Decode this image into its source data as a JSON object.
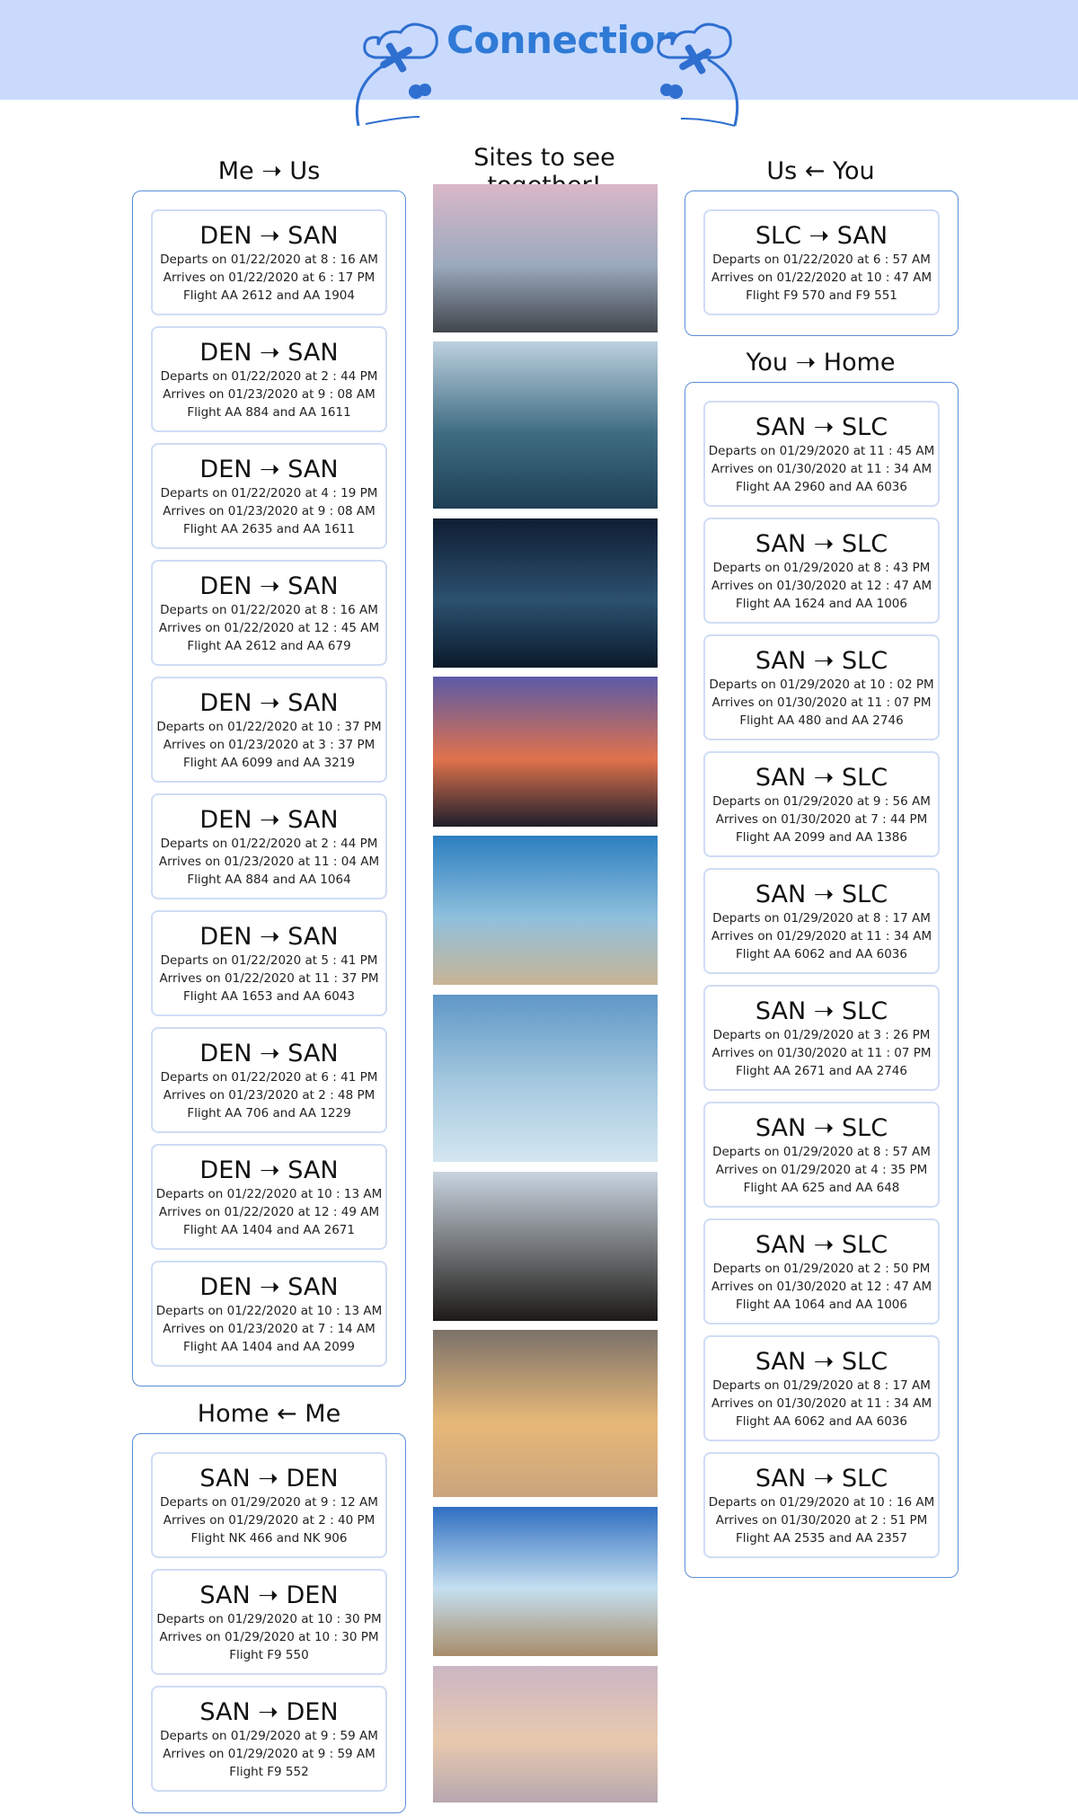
{
  "header": {
    "title": "Connection"
  },
  "left_top": {
    "title": "Me ➝ Us",
    "flights": [
      {
        "route": "DEN ➝ SAN",
        "depart": "Departs on 01/22/2020 at 8 : 16 AM",
        "arrive": "Arrives on 01/22/2020 at 6 : 17 PM",
        "flight": "Flight AA 2612 and AA 1904"
      },
      {
        "route": "DEN ➝ SAN",
        "depart": "Departs on 01/22/2020 at 2 : 44 PM",
        "arrive": "Arrives on 01/23/2020 at 9 : 08 AM",
        "flight": "Flight AA 884 and AA 1611"
      },
      {
        "route": "DEN ➝ SAN",
        "depart": "Departs on 01/22/2020 at 4 : 19 PM",
        "arrive": "Arrives on 01/23/2020 at 9 : 08 AM",
        "flight": "Flight AA 2635 and AA 1611"
      },
      {
        "route": "DEN ➝ SAN",
        "depart": "Departs on 01/22/2020 at 8 : 16 AM",
        "arrive": "Arrives on 01/22/2020 at 12 : 45 AM",
        "flight": "Flight AA 2612 and AA 679"
      },
      {
        "route": "DEN ➝ SAN",
        "depart": "Departs on 01/22/2020 at 10 : 37 PM",
        "arrive": "Arrives on 01/23/2020 at 3 : 37 PM",
        "flight": "Flight AA 6099 and AA 3219"
      },
      {
        "route": "DEN ➝ SAN",
        "depart": "Departs on 01/22/2020 at 2 : 44 PM",
        "arrive": "Arrives on 01/23/2020 at 11 : 04 AM",
        "flight": "Flight AA 884 and AA 1064"
      },
      {
        "route": "DEN ➝ SAN",
        "depart": "Departs on 01/22/2020 at 5 : 41 PM",
        "arrive": "Arrives on 01/22/2020 at 11 : 37 PM",
        "flight": "Flight AA 1653 and AA 6043"
      },
      {
        "route": "DEN ➝ SAN",
        "depart": "Departs on 01/22/2020 at 6 : 41 PM",
        "arrive": "Arrives on 01/23/2020 at 2 : 48 PM",
        "flight": "Flight AA 706 and AA 1229"
      },
      {
        "route": "DEN ➝ SAN",
        "depart": "Departs on 01/22/2020 at 10 : 13 AM",
        "arrive": "Arrives on 01/22/2020 at 12 : 49 AM",
        "flight": "Flight AA 1404 and AA 2671"
      },
      {
        "route": "DEN ➝ SAN",
        "depart": "Departs on 01/22/2020 at 10 : 13 AM",
        "arrive": "Arrives on 01/23/2020 at 7 : 14 AM",
        "flight": "Flight AA 1404 and AA 2099"
      }
    ]
  },
  "left_bottom": {
    "title": "Home ← Me",
    "flights": [
      {
        "route": "SAN ➝ DEN",
        "depart": "Departs on 01/29/2020 at 9 : 12 AM",
        "arrive": "Arrives on 01/29/2020 at 2 : 40 PM",
        "flight": "Flight NK 466 and NK 906"
      },
      {
        "route": "SAN ➝ DEN",
        "depart": "Departs on 01/29/2020 at 10 : 30 PM",
        "arrive": "Arrives on 01/29/2020 at 10 : 30 PM",
        "flight": "Flight F9 550"
      },
      {
        "route": "SAN ➝ DEN",
        "depart": "Departs on 01/29/2020 at 9 : 59 AM",
        "arrive": "Arrives on 01/29/2020 at 9 : 59 AM",
        "flight": "Flight F9 552"
      }
    ]
  },
  "right_top": {
    "title": "Us ← You",
    "flights": [
      {
        "route": "SLC ➝ SAN",
        "depart": "Departs on 01/22/2020 at 6 : 57 AM",
        "arrive": "Arrives on 01/22/2020 at 10 : 47 AM",
        "flight": "Flight F9 570 and F9 551"
      }
    ]
  },
  "right_bottom": {
    "title": "You ➝ Home",
    "flights": [
      {
        "route": "SAN ➝ SLC",
        "depart": "Departs on 01/29/2020 at 11 : 45 AM",
        "arrive": "Arrives on 01/30/2020 at 11 : 34 AM",
        "flight": "Flight AA 2960 and AA 6036"
      },
      {
        "route": "SAN ➝ SLC",
        "depart": "Departs on 01/29/2020 at 8 : 43 PM",
        "arrive": "Arrives on 01/30/2020 at 12 : 47 AM",
        "flight": "Flight AA 1624 and AA 1006"
      },
      {
        "route": "SAN ➝ SLC",
        "depart": "Departs on 01/29/2020 at 10 : 02 PM",
        "arrive": "Arrives on 01/30/2020 at 11 : 07 PM",
        "flight": "Flight AA 480 and AA 2746"
      },
      {
        "route": "SAN ➝ SLC",
        "depart": "Departs on 01/29/2020 at 9 : 56 AM",
        "arrive": "Arrives on 01/30/2020 at 7 : 44 PM",
        "flight": "Flight AA 2099 and AA 1386"
      },
      {
        "route": "SAN ➝ SLC",
        "depart": "Departs on 01/29/2020 at 8 : 17 AM",
        "arrive": "Arrives on 01/29/2020 at 11 : 34 AM",
        "flight": "Flight AA 6062 and AA 6036"
      },
      {
        "route": "SAN ➝ SLC",
        "depart": "Departs on 01/29/2020 at 3 : 26 PM",
        "arrive": "Arrives on 01/30/2020 at 11 : 07 PM",
        "flight": "Flight AA 2671 and AA 2746"
      },
      {
        "route": "SAN ➝ SLC",
        "depart": "Departs on 01/29/2020 at 8 : 57 AM",
        "arrive": "Arrives on 01/29/2020 at 4 : 35 PM",
        "flight": "Flight AA 625 and AA 648"
      },
      {
        "route": "SAN ➝ SLC",
        "depart": "Departs on 01/29/2020 at 2 : 50 PM",
        "arrive": "Arrives on 01/30/2020 at 12 : 47 AM",
        "flight": "Flight AA 1064 and AA 1006"
      },
      {
        "route": "SAN ➝ SLC",
        "depart": "Departs on 01/29/2020 at 8 : 17 AM",
        "arrive": "Arrives on 01/30/2020 at 11 : 34 AM",
        "flight": "Flight AA 6062 and AA 6036"
      },
      {
        "route": "SAN ➝ SLC",
        "depart": "Departs on 01/29/2020 at 10 : 16 AM",
        "arrive": "Arrives on 01/30/2020 at 2 : 51 PM",
        "flight": "Flight AA 2535 and AA 2357"
      }
    ]
  },
  "sites": {
    "title": "Sites to see together!",
    "photos": [
      {
        "name": "coastal-waves-photo",
        "sky": "#d9b7c8",
        "mid": "#9aa9bd",
        "bottom": "#41464c"
      },
      {
        "name": "bay-skyline-photo",
        "sky": "#bcd0df",
        "mid": "#3f6c82",
        "bottom": "#1d3f55"
      },
      {
        "name": "night-skyline-photo",
        "sky": "#0f1e33",
        "mid": "#2c5170",
        "bottom": "#0a1a2b"
      },
      {
        "name": "sunset-city-photo",
        "sky": "#5a5aa8",
        "mid": "#e0724c",
        "bottom": "#1e1f2c"
      },
      {
        "name": "palm-beach-photo",
        "sky": "#2c7fc0",
        "mid": "#8fc0dd",
        "bottom": "#c8b495"
      },
      {
        "name": "tall-palms-photo",
        "sky": "#5f97c7",
        "mid": "#a7cae0",
        "bottom": "#d3e6f0"
      },
      {
        "name": "palm-silhouette-photo",
        "sky": "#c9d4e0",
        "mid": "#6b6e70",
        "bottom": "#1c1a18"
      },
      {
        "name": "golden-cliff-photo",
        "sky": "#7b7169",
        "mid": "#e6b877",
        "bottom": "#caa47e"
      },
      {
        "name": "bird-sky-photo",
        "sky": "#2f6fc1",
        "mid": "#c5dff0",
        "bottom": "#a88d6b"
      },
      {
        "name": "pier-sunset-photo",
        "sky": "#cbb6c4",
        "mid": "#e8c9ad",
        "bottom": "#b7a7b0"
      }
    ]
  }
}
